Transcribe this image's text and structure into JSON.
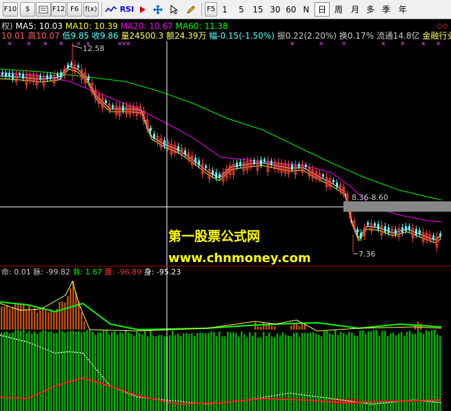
{
  "toolbar": {
    "buttons": [
      "F10",
      "$",
      "F12",
      "F6",
      "f(x)"
    ],
    "periods": [
      "F5",
      "1",
      "5",
      "15",
      "30",
      "60",
      "N",
      "日",
      "周",
      "月",
      "多",
      "季",
      "年"
    ],
    "rsi_label": "RSI"
  },
  "ma_line": {
    "mode": "权)",
    "ma5": "MA5: 10.03",
    "ma10": "MA10: 10.39",
    "ma20": "MA20: 10.67",
    "ma60": "MA60: 11.38"
  },
  "quote_line": {
    "open": "10.01",
    "high": "高10.07",
    "low": "低9.85",
    "close": "收9.86",
    "volume": "量24500.3",
    "amount": "额2",
    "amount_rest": "4.39万",
    "change": "幅-0.15(-1.50%)",
    "amplitude": "振0.22(2.20%)",
    "turnover": "换0.17%",
    "float_cap": "流通14.8亿",
    "industry": "金融行业"
  },
  "price_labels": {
    "high": "12.58",
    "cross": "8.36-8.60",
    "low": "7.36"
  },
  "watermark": {
    "title": "第一股票公式网",
    "url": "www.chnmoney.com"
  },
  "indicator_line": {
    "a": "命: 0.01",
    "b": "脉: -99.82",
    "c": "背: 1.67",
    "d": "腰: -96.89",
    "e": "身: -95.23"
  },
  "colors": {
    "up": "#ff4040",
    "down": "#54ffff",
    "ma5": "#ffffff",
    "ma10": "#ffff00",
    "ma20": "#ff00ff",
    "ma60": "#00ff00",
    "bar_green": "#00cc00",
    "bar_red": "#c05010"
  },
  "icons": [
    "f10-icon",
    "dollar-icon",
    "f12-icon",
    "f6-icon",
    "fx-icon",
    "chart-icon",
    "rsi-icon",
    "move-icon",
    "cursor-icon",
    "pen-icon"
  ]
}
